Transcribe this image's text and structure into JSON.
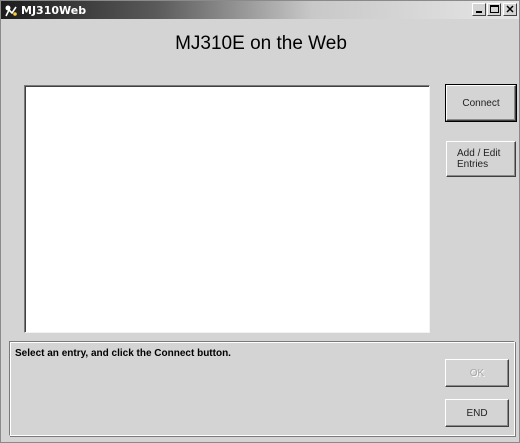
{
  "window": {
    "title": "MJ310Web"
  },
  "heading": "MJ310E on the Web",
  "entries": [],
  "buttons": {
    "connect": "Connect",
    "add_edit_line1": "Add / Edit",
    "add_edit_line2": "Entries",
    "ok": "OK",
    "end": "END"
  },
  "status": {
    "message": "Select an entry, and click the Connect button."
  },
  "icons": {
    "app": "app-logo-icon",
    "minimize": "minimize-icon",
    "maximize": "maximize-icon",
    "close": "close-icon"
  },
  "colors": {
    "window_bg": "#d4d4d4",
    "titlebar_start": "#1c1c1c",
    "titlebar_end": "#e6e6e6",
    "list_bg": "#ffffff",
    "disabled_text": "#a8a8a8"
  }
}
